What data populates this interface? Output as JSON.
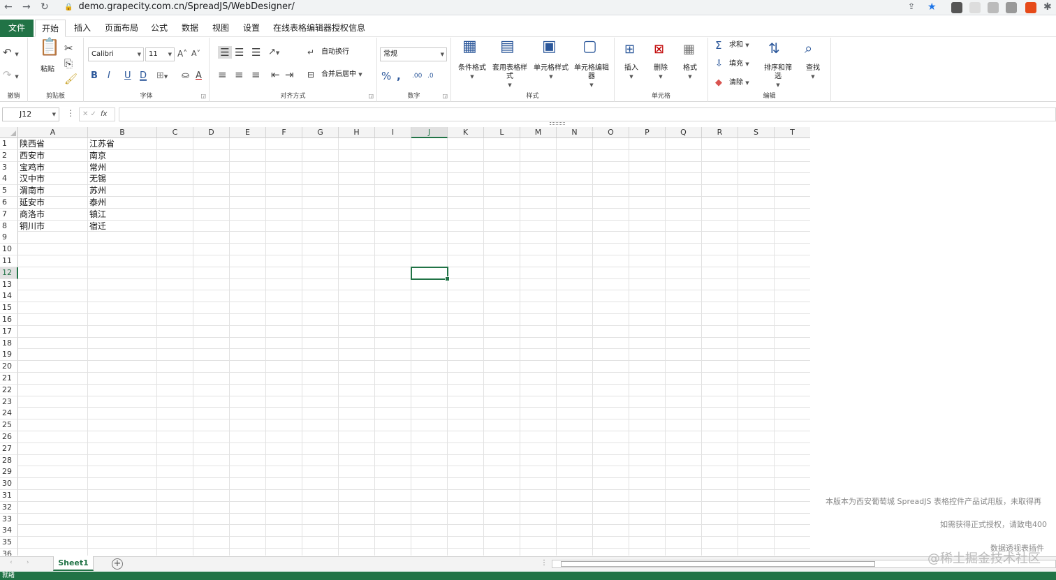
{
  "browser": {
    "url": "demo.grapecity.com.cn/SpreadJS/WebDesigner/"
  },
  "menu": {
    "tabs": [
      "文件",
      "开始",
      "插入",
      "页面布局",
      "公式",
      "数据",
      "视图",
      "设置",
      "在线表格编辑器授权信息"
    ]
  },
  "ribbon": {
    "undo_group": "撤销",
    "clipboard": {
      "paste": "粘贴",
      "label": "剪贴板"
    },
    "font": {
      "family": "Calibri",
      "size": "11",
      "label": "字体"
    },
    "alignment": {
      "wrap": "自动换行",
      "merge": "合并后居中",
      "label": "对齐方式"
    },
    "number": {
      "format": "常规",
      "label": "数字"
    },
    "styles": {
      "conditional": "条件格式",
      "table_style": "套用表格样式",
      "cell_style": "单元格样式",
      "cell_editor": "单元格编辑器",
      "label": "样式"
    },
    "cells": {
      "insert": "插入",
      "delete": "删除",
      "format": "格式",
      "label": "单元格"
    },
    "editing": {
      "sum": "求和",
      "fill": "填充",
      "clear": "清除",
      "sort": "排序和筛选",
      "find": "查找",
      "label": "编辑"
    }
  },
  "formula_bar": {
    "name_box": "J12",
    "fx": "fx",
    "cancel_confirm": "✕ ✓",
    "value": ""
  },
  "sheet": {
    "columns": [
      "A",
      "B",
      "C",
      "D",
      "E",
      "F",
      "G",
      "H",
      "I",
      "J",
      "K",
      "L",
      "M",
      "N",
      "O",
      "P",
      "Q",
      "R",
      "S",
      "T"
    ],
    "selected_column": "J",
    "selected_row": 12,
    "row_count": 36,
    "cells": [
      [
        "陕西省",
        "江苏省"
      ],
      [
        "西安市",
        "南京"
      ],
      [
        "宝鸡市",
        "常州"
      ],
      [
        "汉中市",
        "无锡"
      ],
      [
        "渭南市",
        "苏州"
      ],
      [
        "延安市",
        "泰州"
      ],
      [
        "商洛市",
        "镇江"
      ],
      [
        "铜川市",
        "宿迁"
      ]
    ]
  },
  "notice": {
    "line1": "本版本为西安葡萄城 SpreadJS 表格控件产品试用版，未取得再",
    "line2": "如需获得正式授权，请致电400",
    "line3": "数据透视表插件"
  },
  "tabs_bar": {
    "sheet_name": "Sheet1",
    "add": "+"
  },
  "watermark": "@稀土掘金技术社区",
  "status": "就绪"
}
